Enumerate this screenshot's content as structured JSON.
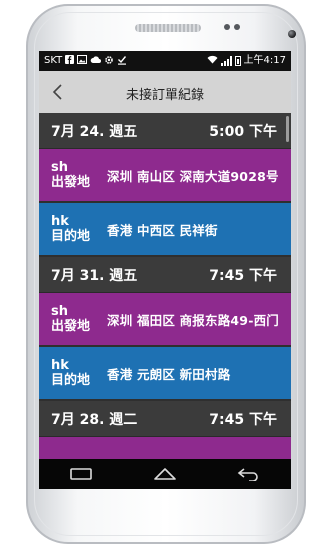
{
  "status_bar": {
    "carrier": "SKT",
    "time": "上午4:17",
    "icons": [
      "facebook-icon",
      "image-icon",
      "cloud-icon",
      "settings-icon",
      "download-check-icon",
      "wifi-icon",
      "signal-icon",
      "battery-icon"
    ]
  },
  "app_bar": {
    "back_icon": "chevron-left-icon",
    "title": "未接訂單紀錄"
  },
  "orders": [
    {
      "date": "7月 24. 週五",
      "time": "5:00 下午",
      "from": {
        "code": "sh",
        "label": "出發地",
        "address": "深圳 南山区 深南大道9028号"
      },
      "to": {
        "code": "hk",
        "label": "目的地",
        "address": "香港 中西区 民祥街"
      }
    },
    {
      "date": "7月 31. 週五",
      "time": "7:45 下午",
      "from": {
        "code": "sh",
        "label": "出發地",
        "address": "深圳 福田区 商报东路49-西门"
      },
      "to": {
        "code": "hk",
        "label": "目的地",
        "address": "香港 元朗区 新田村路"
      }
    },
    {
      "date": "7月 28. 週二",
      "time": "7:45 下午"
    }
  ],
  "nav_bar": {
    "icons": [
      "recent-apps-icon",
      "home-icon",
      "back-arrow-icon"
    ]
  },
  "colors": {
    "from_row": "#8e2a8e",
    "to_row": "#1e71b3",
    "date_header": "#3b3b3b",
    "app_bar": "#d4d4d4"
  }
}
